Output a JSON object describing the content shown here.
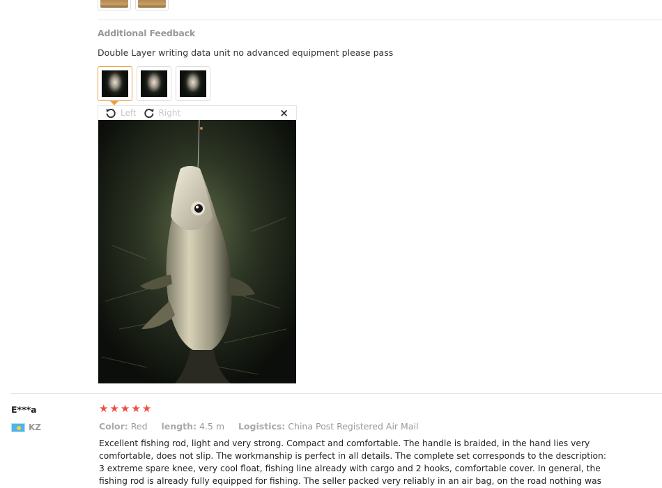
{
  "previous_review": {
    "thumbnails": [
      "wood-photo",
      "wood-photo"
    ]
  },
  "additional_feedback": {
    "title": "Additional Feedback",
    "text": "Double Layer writing data unit no advanced equipment please pass",
    "thumbnails": [
      "fish-photo-1",
      "fish-photo-2",
      "fish-photo-3"
    ],
    "active_thumbnail": 0
  },
  "viewer": {
    "rotate_left_label": "Left",
    "rotate_right_label": "Right",
    "close_icon": "×"
  },
  "review": {
    "user": "E***a",
    "country_code": "KZ",
    "rating": 5,
    "stars": [
      "★",
      "★",
      "★",
      "★",
      "★"
    ],
    "color_key": "Color:",
    "color_value": "Red",
    "length_key": "length:",
    "length_value": "4.5 m",
    "logistics_key": "Logistics:",
    "logistics_value": "China Post Registered Air Mail",
    "text": "Excellent fishing rod, light and very strong. Compact and comfortable. The handle is braided, in the hand lies very comfortable, does not slip. The workmanship is perfect in all details. The complete set corresponds to the description: 3 extreme spare knee, very cool float, fishing line already with cargo and 2 hooks, comfortable cover. In general, the fishing rod is already fully equipped for fishing. The seller packed very reliably in an air bag, on the road nothing was"
  },
  "colors": {
    "accent_orange": "#e9a143",
    "star_red": "#f04c3e",
    "muted_gray": "#999999"
  }
}
